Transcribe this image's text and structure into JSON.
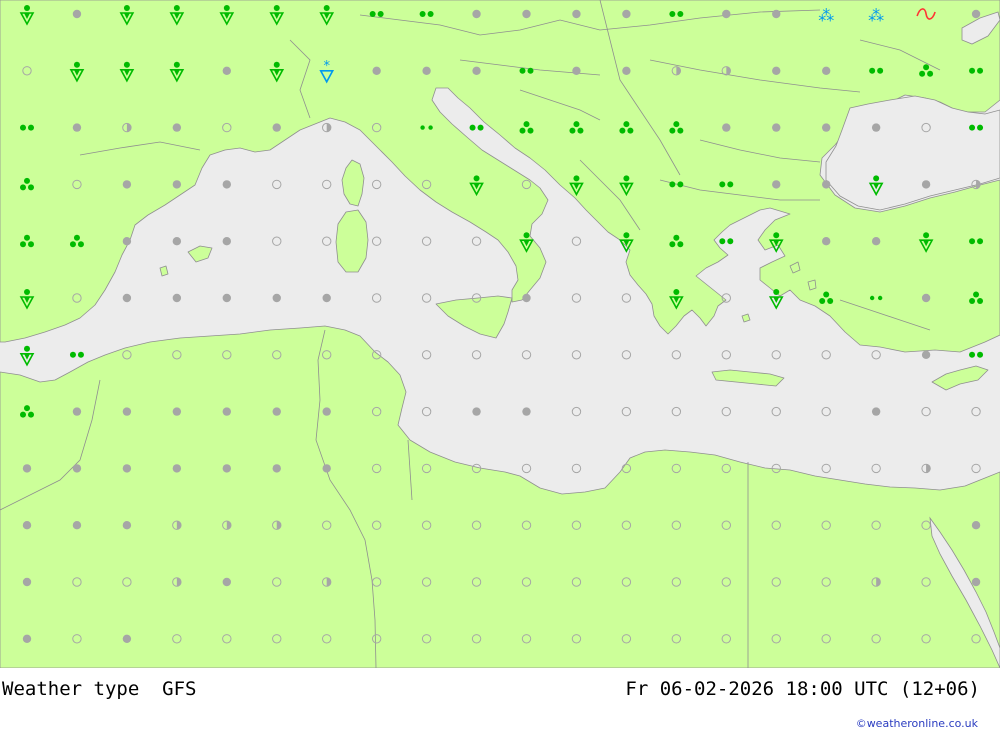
{
  "footer": {
    "title": "Weather type",
    "model": "GFS",
    "datetime": "Fr 06-02-2026 18:00 UTC (12+06)",
    "credit": "©weatheronline.co.uk"
  },
  "colors": {
    "land": "#ccff99",
    "sea": "#ececec",
    "border": "#9a9a9a",
    "dry": "#a6a6a6",
    "rain": "#00bb00",
    "snow": "#0099ee",
    "fog": "#ff3333"
  },
  "grid": {
    "cols": 20,
    "rows": 12,
    "cells": [
      "shower-rain,dry,shower-rain,shower-rain,shower-rain,shower-rain,shower-rain,rain,rain,dry,dry,dry,dry,rain,dry,dry,snow,snow,fog,dry",
      "clear,shower-rain,shower-rain,shower-rain,dry,shower-rain,shower-snow,dry,dry,dry,rain,dry,dry,partly,partly,dry,dry,rain,heavy-rain,rain",
      "rain,dry,partly,dry,clear,dry,partly,clear,light-rain,rain,heavy-rain,heavy-rain,heavy-rain,heavy-rain,dry,dry,dry,dry,clear,rain",
      "heavy-rain,clear,dry,dry,dry,clear,clear,clear,clear,shower-rain,clear,shower-rain,shower-rain,rain,rain,dry,dry,shower-rain,dry,partly",
      "heavy-rain,heavy-rain,dry,dry,dry,clear,clear,clear,clear,clear,shower-rain,clear,shower-rain,heavy-rain,rain,shower-rain,dry,dry,shower-rain,rain",
      "shower-rain,clear,dry,dry,dry,dry,dry,clear,clear,clear,dry,clear,clear,shower-rain,clear,shower-rain,heavy-rain,light-rain,dry,heavy-rain",
      "shower-rain,rain,clear,clear,clear,clear,clear,clear,clear,clear,clear,clear,clear,clear,clear,clear,clear,clear,dry,rain",
      "heavy-rain,dry,dry,dry,dry,dry,dry,clear,clear,dry,dry,clear,clear,clear,clear,clear,clear,dry,clear,clear",
      "dry,dry,dry,dry,dry,dry,dry,clear,clear,clear,clear,clear,clear,clear,clear,clear,clear,clear,partly,clear",
      "dry,dry,dry,partly,partly,partly,clear,clear,clear,clear,clear,clear,clear,clear,clear,clear,clear,clear,clear,dry",
      "dry,clear,clear,partly,dry,clear,partly,clear,clear,clear,clear,clear,clear,clear,clear,clear,clear,partly,clear,dry",
      "dry,clear,dry,clear,clear,clear,clear,clear,clear,clear,clear,clear,clear,clear,clear,clear,clear,clear,clear,clear"
    ]
  }
}
